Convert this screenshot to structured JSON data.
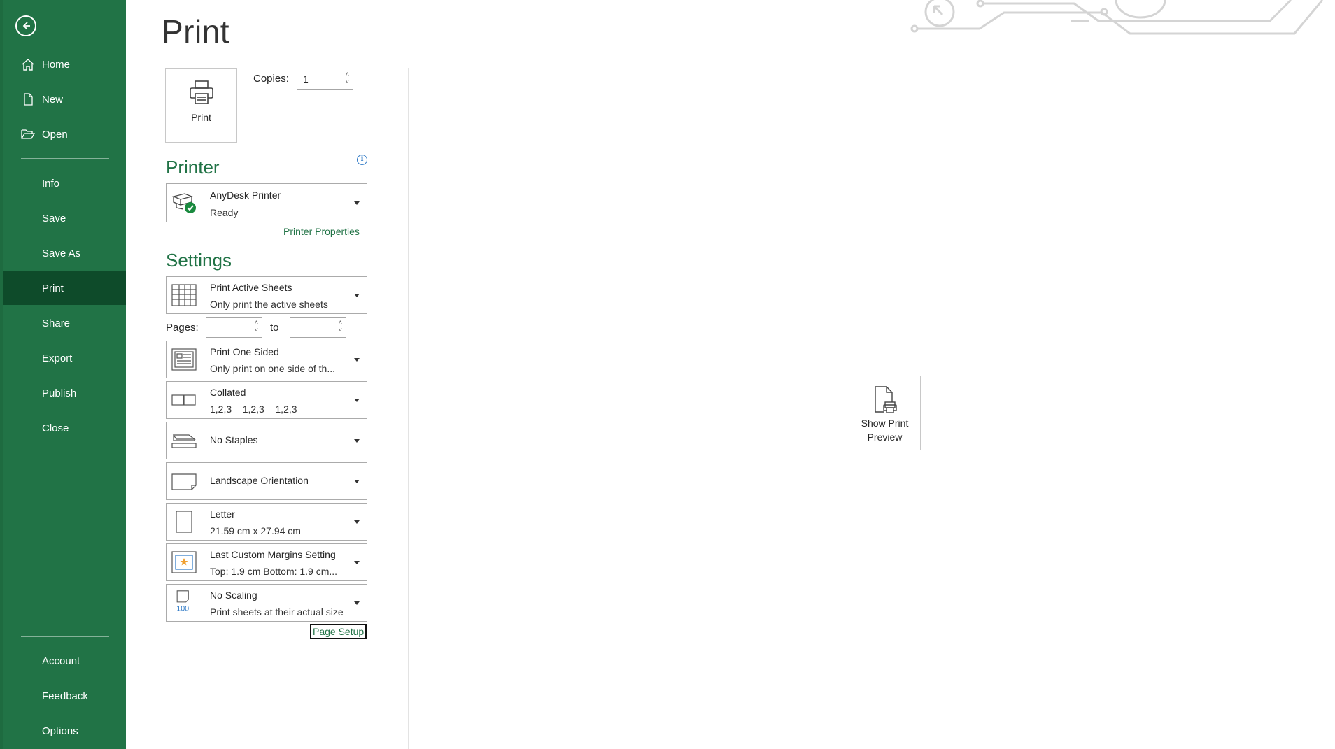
{
  "sidebar": {
    "items": [
      {
        "label": "Home"
      },
      {
        "label": "New"
      },
      {
        "label": "Open"
      },
      {
        "label": "Info"
      },
      {
        "label": "Save"
      },
      {
        "label": "Save As"
      },
      {
        "label": "Print"
      },
      {
        "label": "Share"
      },
      {
        "label": "Export"
      },
      {
        "label": "Publish"
      },
      {
        "label": "Close"
      },
      {
        "label": "Account"
      },
      {
        "label": "Feedback"
      },
      {
        "label": "Options"
      }
    ],
    "active": "Print"
  },
  "main": {
    "title": "Print",
    "print_button_label": "Print",
    "copies_label": "Copies:",
    "copies_value": "1",
    "printer": {
      "heading": "Printer",
      "name": "AnyDesk Printer",
      "status": "Ready",
      "properties_link": "Printer Properties"
    },
    "settings": {
      "heading": "Settings",
      "pages_label": "Pages:",
      "to_label": "to",
      "options": [
        {
          "line1": "Print Active Sheets",
          "line2": "Only print the active sheets"
        },
        {
          "line1": "Print One Sided",
          "line2": "Only print on one side of th..."
        },
        {
          "line1": "Collated",
          "line2": "1,2,3    1,2,3    1,2,3"
        },
        {
          "line1": "No Staples",
          "line2": ""
        },
        {
          "line1": "Landscape Orientation",
          "line2": ""
        },
        {
          "line1": "Letter",
          "line2": "21.59 cm x 27.94 cm"
        },
        {
          "line1": "Last Custom Margins Setting",
          "line2": "Top: 1.9 cm Bottom: 1.9 cm..."
        },
        {
          "line1": "No Scaling",
          "line2": "Print sheets at their actual size"
        }
      ],
      "scaling_icon_text": "100",
      "page_setup_link": "Page Setup"
    },
    "preview_button_label": "Show Print Preview"
  },
  "colors": {
    "accent": "#217346",
    "active_nav": "#0e4b2a"
  }
}
